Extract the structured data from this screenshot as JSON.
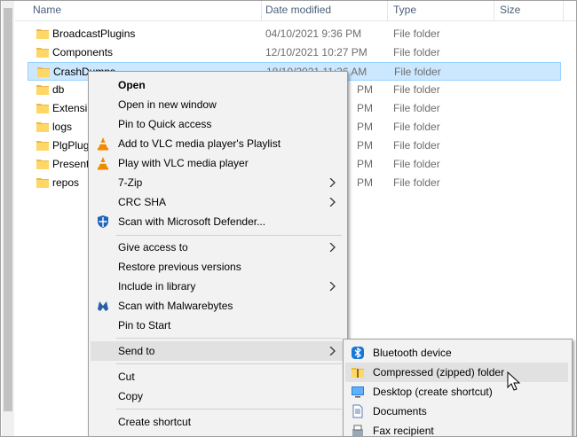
{
  "header": {
    "name": "Name",
    "date": "Date modified",
    "type": "Type",
    "size": "Size"
  },
  "rows": [
    {
      "name": "BroadcastPlugins",
      "date": "04/10/2021 9:36 PM",
      "type": "File folder"
    },
    {
      "name": "Components",
      "date": "12/10/2021 10:27 PM",
      "type": "File folder"
    },
    {
      "name": "CrashDumps",
      "date": "18/10/2021 11:36 AM",
      "type": "File folder"
    },
    {
      "name": "db",
      "date": "",
      "type": "File folder"
    },
    {
      "name": "Extensi",
      "date": "",
      "type": "File folder"
    },
    {
      "name": "logs",
      "date": "",
      "type": "File folder"
    },
    {
      "name": "PlgPlug",
      "date": "",
      "type": "File folder"
    },
    {
      "name": "Present",
      "date": "",
      "type": "File folder"
    },
    {
      "name": "repos",
      "date": "",
      "type": "File folder"
    }
  ],
  "rowDateFragments": [
    "PM",
    "PM",
    "PM",
    "PM",
    "PM",
    "PM"
  ],
  "context_menu": {
    "open": "Open",
    "open_new_window": "Open in new window",
    "pin_quick": "Pin to Quick access",
    "vlc_add": "Add to VLC media player's Playlist",
    "vlc_play": "Play with VLC media player",
    "zip7": "7-Zip",
    "crc": "CRC SHA",
    "defender": "Scan with Microsoft Defender...",
    "give_access": "Give access to",
    "restore": "Restore previous versions",
    "include_lib": "Include in library",
    "malwarebytes": "Scan with Malwarebytes",
    "pin_start": "Pin to Start",
    "send_to": "Send to",
    "cut": "Cut",
    "copy": "Copy",
    "create_shortcut": "Create shortcut"
  },
  "send_to_menu": {
    "bluetooth": "Bluetooth device",
    "zip": "Compressed (zipped) folder",
    "desktop": "Desktop (create shortcut)",
    "documents": "Documents",
    "fax": "Fax recipient"
  },
  "colors": {
    "folder": "#ffd766",
    "selection": "#cce8ff",
    "menu_bg": "#f2f2f2",
    "highlight": "#e1e1e1"
  }
}
